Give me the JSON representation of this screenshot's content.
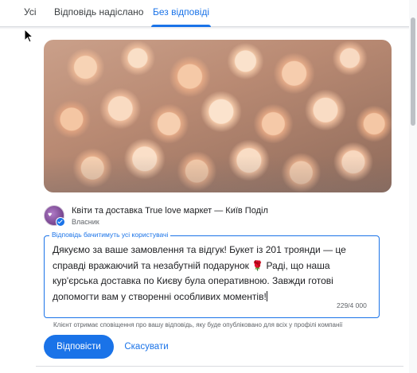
{
  "tabs": [
    {
      "label": "Усі"
    },
    {
      "label": "Відповідь надіслано"
    },
    {
      "label": "Без відповіді"
    }
  ],
  "review_photo": {
    "description_icon": "roses-photo"
  },
  "business": {
    "name": "Квіти та доставка True love маркет — Київ Поділ",
    "role": "Власник",
    "verified_icon": "verified-check-icon"
  },
  "reply": {
    "label": "Відповідь бачитимуть усі користувачі",
    "text": "Дякуємо за ваше замовлення та відгук! Букет із 201 троянди — це справді вражаючий та незабутній подарунок 🌹 Раді, що наша кур'єрська доставка по Києву була оперативною. Завжди готові допомогти вам у створенні особливих моментів!",
    "counter": "229/4 000",
    "notice": "Клієнт отримає сповіщення про вашу відповідь, яку буде опубліковано для всіх у профілі компанії"
  },
  "actions": {
    "submit_label": "Відповісти",
    "cancel_label": "Скасувати"
  },
  "colors": {
    "accent": "#1a73e8",
    "text": "#202124",
    "muted": "#5f6368"
  }
}
